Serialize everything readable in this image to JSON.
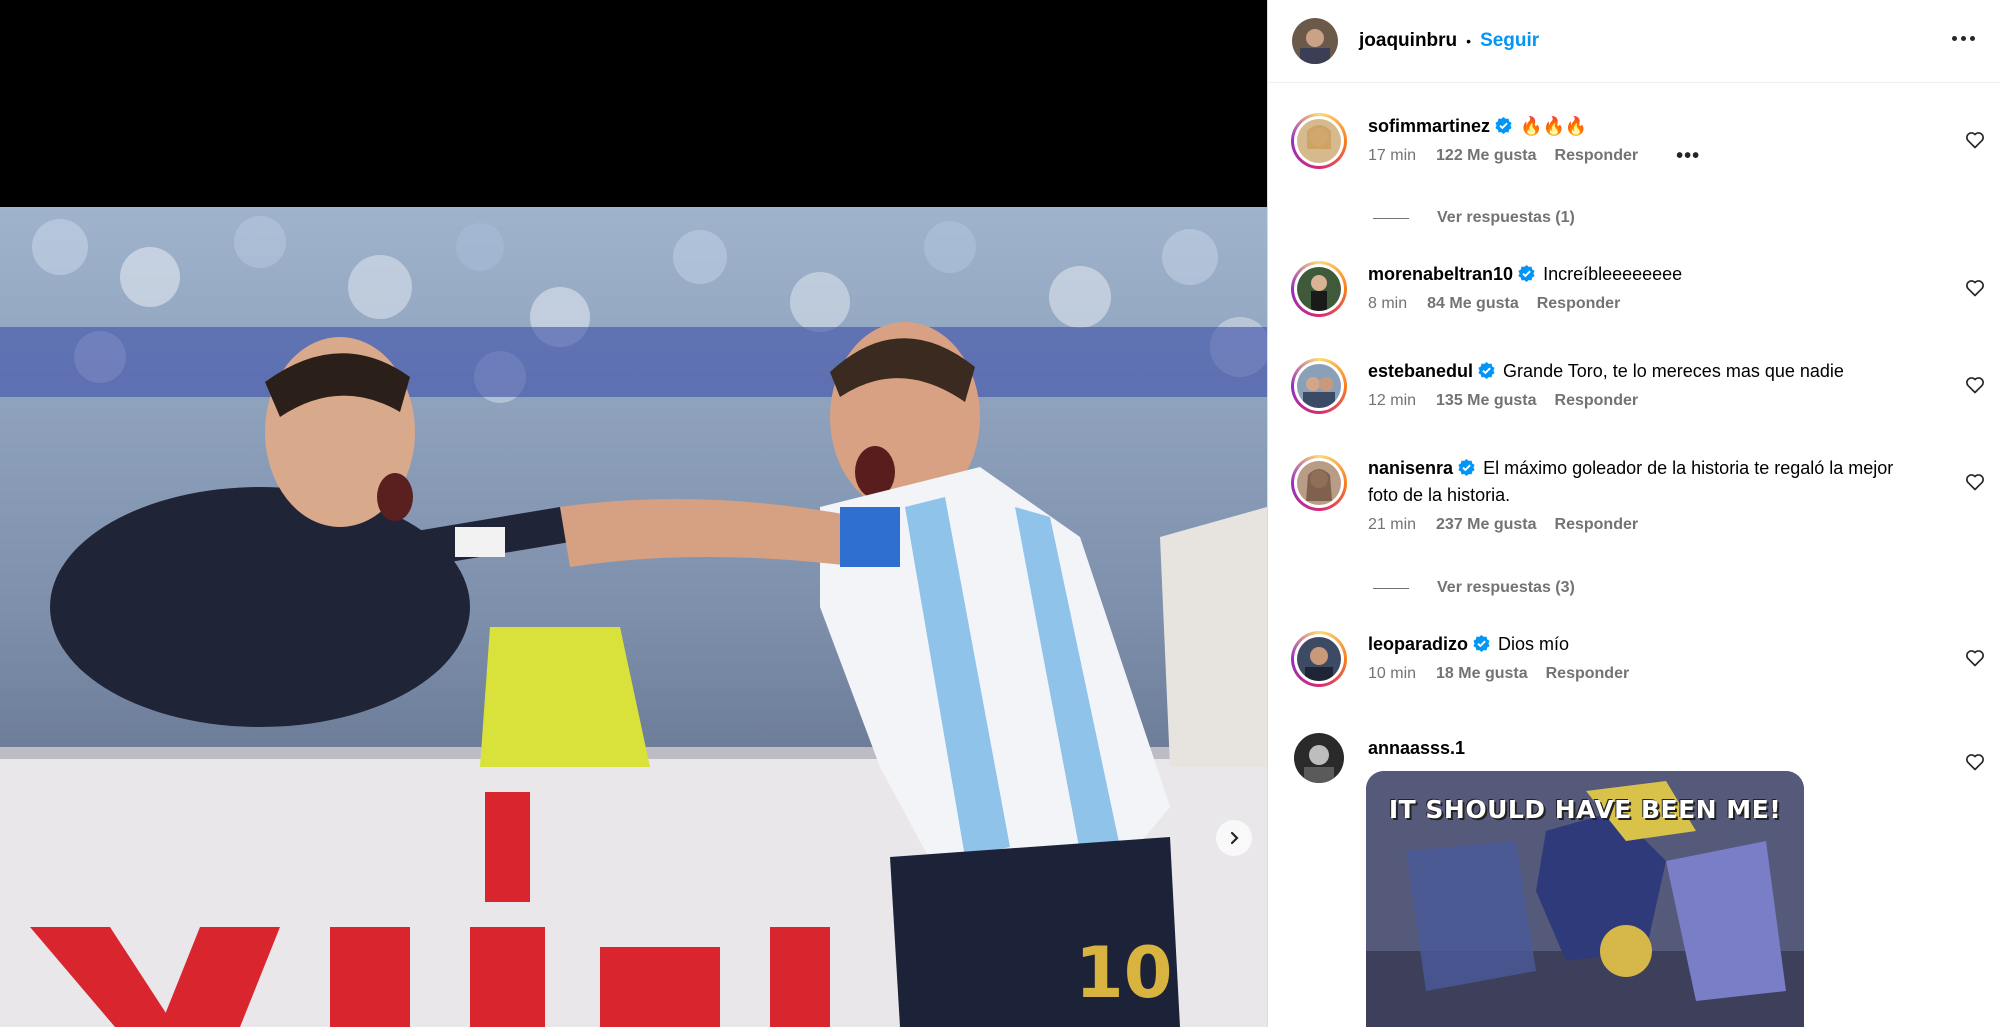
{
  "post": {
    "author": "joaquinbru",
    "separator": "•",
    "follow_label": "Seguir",
    "image_alt": "Photo of an Argentina player in jersey number 10 celebrating with a man in a suit at a stadium",
    "jersey_number": "10"
  },
  "comments": [
    {
      "user": "sofimmartinez",
      "verified": true,
      "text": "🔥🔥🔥",
      "time": "17 min",
      "likes": "122 Me gusta",
      "reply": "Responder",
      "options": "•••",
      "replies_label": "Ver respuestas (1)"
    },
    {
      "user": "morenabeltran10",
      "verified": true,
      "text": "Increíbleeeeeeee",
      "time": "8 min",
      "likes": "84 Me gusta",
      "reply": "Responder"
    },
    {
      "user": "estebanedul",
      "verified": true,
      "text": "Grande Toro, te lo mereces mas que nadie",
      "time": "12 min",
      "likes": "135 Me gusta",
      "reply": "Responder"
    },
    {
      "user": "nanisenra",
      "verified": true,
      "text": "El máximo goleador de la historia te regaló la mejor foto de la historia.",
      "time": "21 min",
      "likes": "237 Me gusta",
      "reply": "Responder",
      "replies_label": "Ver respuestas (3)"
    },
    {
      "user": "leoparadizo",
      "verified": true,
      "text": "Dios mío",
      "time": "10 min",
      "likes": "18 Me gusta",
      "reply": "Responder"
    },
    {
      "user": "annaasss.1",
      "verified": false,
      "gif_caption": "IT SHOULD HAVE BEEN ME!"
    }
  ],
  "colors": {
    "accent": "#0095f6",
    "muted": "#737373",
    "verified": "#0095f6"
  },
  "icons": {
    "next": "chevron-right-icon",
    "more": "more-options-icon",
    "heart": "heart-outline-icon",
    "verified": "verified-badge-icon"
  }
}
